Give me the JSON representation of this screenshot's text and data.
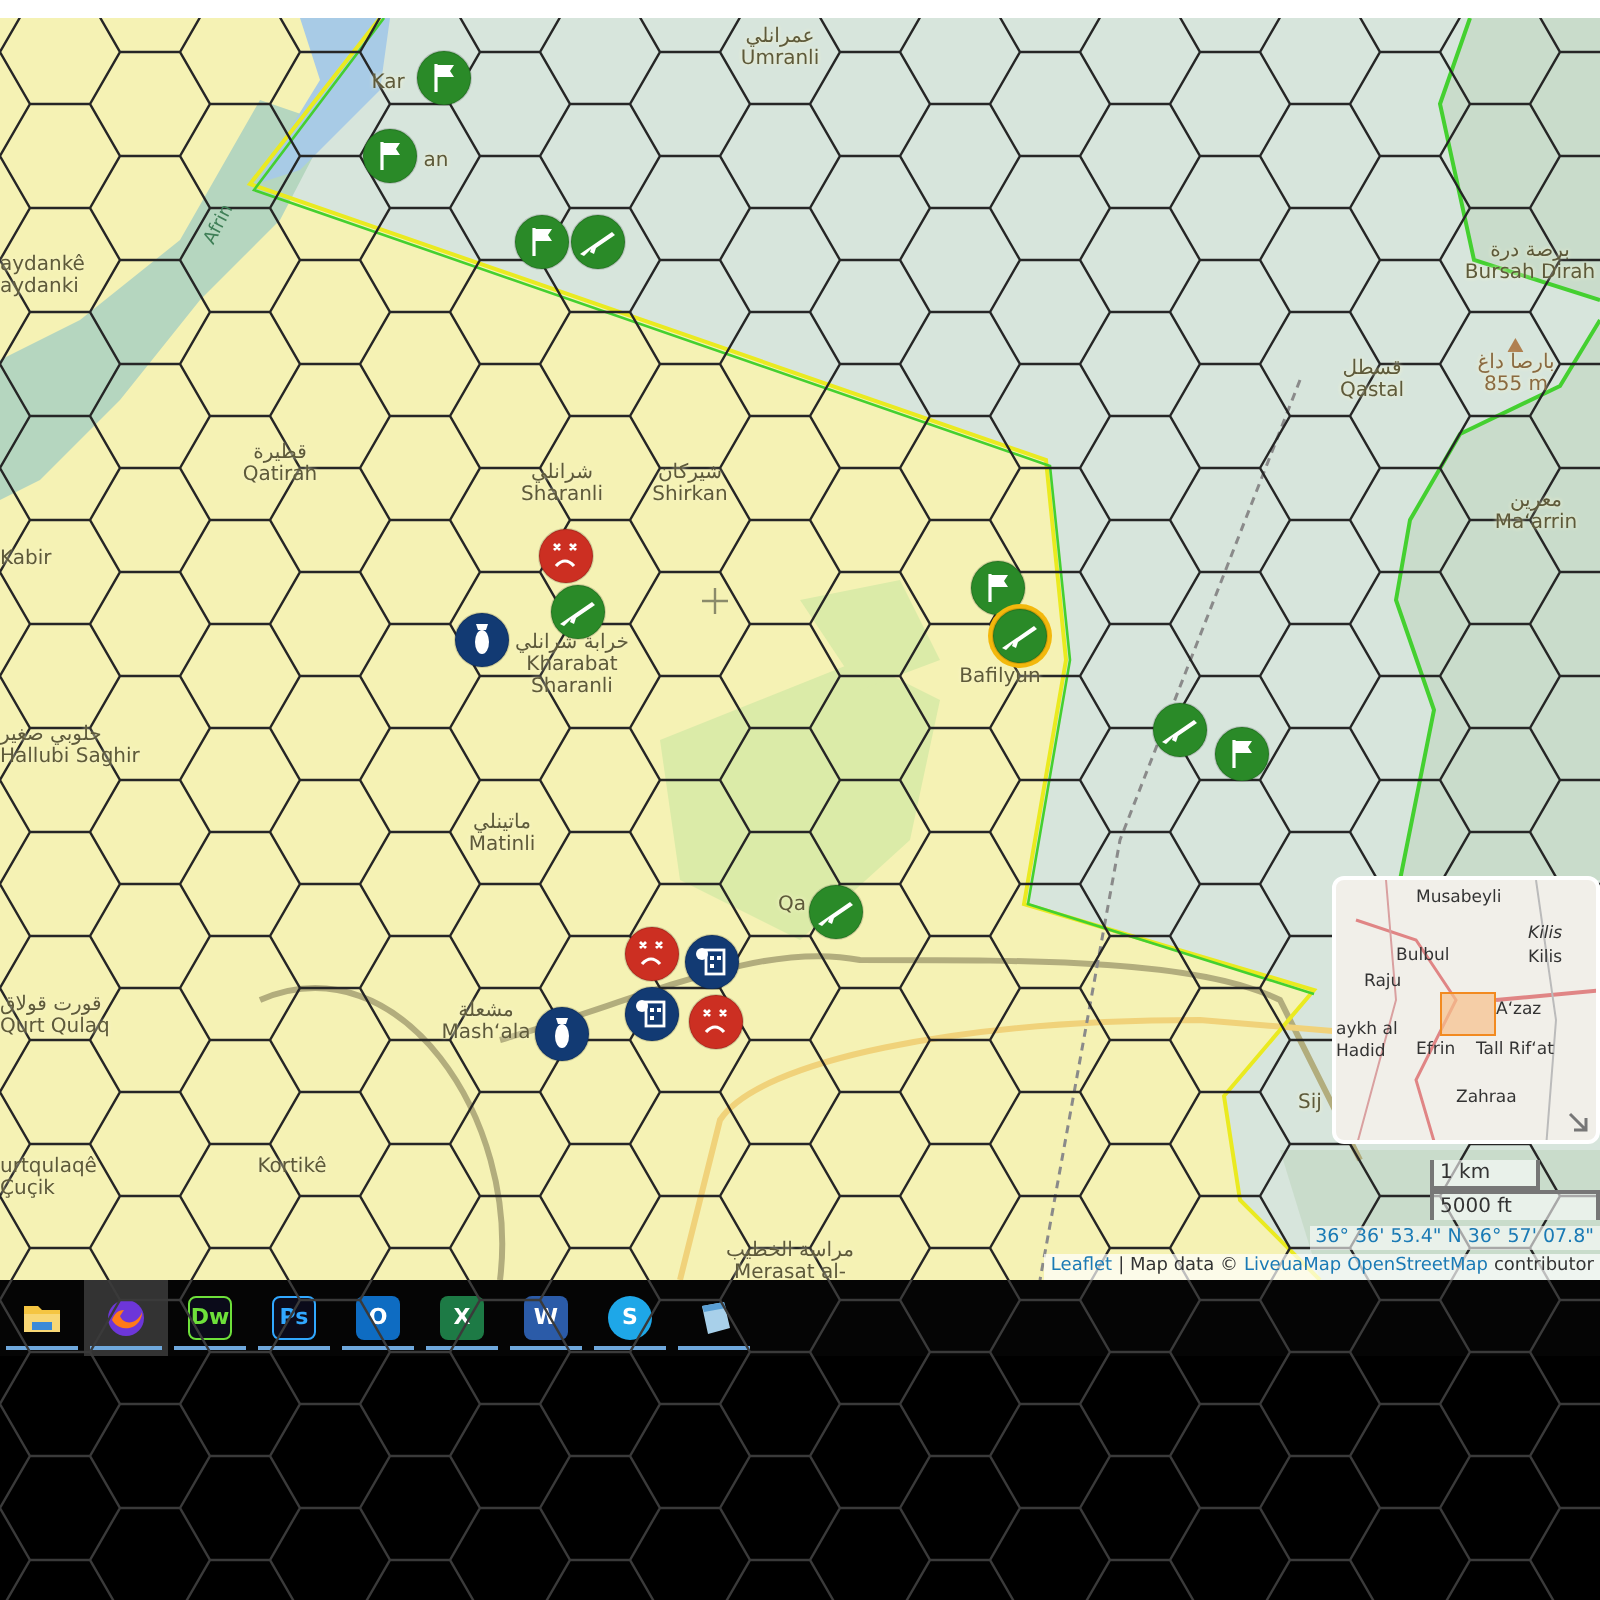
{
  "map": {
    "places": [
      {
        "kind": "town",
        "lines": [
          "عمرانلي",
          "Umranli"
        ]
      },
      {
        "kind": "town",
        "lines": [
          "Kar"
        ]
      },
      {
        "kind": "town",
        "lines": [
          "an"
        ]
      },
      {
        "kind": "town",
        "lines": [
          "aydankê",
          "aydanki"
        ]
      },
      {
        "kind": "town",
        "lines": [
          "قطيرة",
          "Qatirah"
        ]
      },
      {
        "kind": "town",
        "lines": [
          "Kabir"
        ]
      },
      {
        "kind": "town",
        "lines": [
          "شرانلي",
          "Sharanli"
        ]
      },
      {
        "kind": "town",
        "lines": [
          "شيركان",
          "Shirkan"
        ]
      },
      {
        "kind": "town",
        "lines": [
          "خرابة شرانلي",
          "Kharabat",
          "Sharanli"
        ]
      },
      {
        "kind": "town",
        "lines": [
          "Bafilyun"
        ]
      },
      {
        "kind": "town",
        "lines": [
          "برصة درة",
          "Bursah Dirah"
        ]
      },
      {
        "kind": "town",
        "lines": [
          "قسطل",
          "Qastal"
        ]
      },
      {
        "kind": "peak",
        "lines": [
          "بارصا داغ",
          "855 m"
        ]
      },
      {
        "kind": "town",
        "lines": [
          "معرين",
          "Ma‘arrin"
        ]
      },
      {
        "kind": "town",
        "lines": [
          "حلوبي صغير",
          "Hallubi Saghir"
        ]
      },
      {
        "kind": "town",
        "lines": [
          "ماتينلي",
          "Matinli"
        ]
      },
      {
        "kind": "town",
        "lines": [
          "Qa"
        ]
      },
      {
        "kind": "town",
        "lines": [
          "قورت قولاق",
          "Qurt Qulaq"
        ]
      },
      {
        "kind": "town",
        "lines": [
          "مشعلة",
          "Mash‘ala"
        ]
      },
      {
        "kind": "town",
        "lines": [
          "urtqulaqê",
          "Çuçik"
        ]
      },
      {
        "kind": "town",
        "lines": [
          "Kortikê"
        ]
      },
      {
        "kind": "town",
        "lines": [
          "مراسة الخطيب",
          "Merasat al-"
        ]
      },
      {
        "kind": "town",
        "lines": [
          "Sij"
        ]
      }
    ],
    "river_label": "Afrin",
    "markers": [
      {
        "kind": "flag",
        "selected": false
      },
      {
        "kind": "flag",
        "selected": false
      },
      {
        "kind": "flag",
        "selected": false
      },
      {
        "kind": "rifle",
        "selected": false
      },
      {
        "kind": "sad",
        "selected": false
      },
      {
        "kind": "rifle",
        "selected": false
      },
      {
        "kind": "bomb",
        "selected": false
      },
      {
        "kind": "flag",
        "selected": false
      },
      {
        "kind": "rifle",
        "selected": true
      },
      {
        "kind": "rifle",
        "selected": false
      },
      {
        "kind": "flag",
        "selected": false
      },
      {
        "kind": "rifle",
        "selected": false
      },
      {
        "kind": "sad",
        "selected": false
      },
      {
        "kind": "building",
        "selected": false
      },
      {
        "kind": "building",
        "selected": false
      },
      {
        "kind": "sad",
        "selected": false
      },
      {
        "kind": "bomb",
        "selected": false
      }
    ]
  },
  "minimap": {
    "places": [
      "Musabeyli",
      "Bulbul",
      "Kilis",
      "Kilis",
      "Raju",
      "aykh al",
      "Hadid",
      "Efrin",
      "A‘zaz",
      "Tall Rif‘at",
      "Zahraa"
    ]
  },
  "scale": [
    "1 km",
    "5000 ft"
  ],
  "coordinates": "36° 36' 53.4\" N 36° 57' 07.8\"",
  "attribution": [
    {
      "text": "Leaflet",
      "link": true
    },
    {
      "text": "| Map data ©",
      "link": false
    },
    {
      "text": "LiveuaMap",
      "link": true
    },
    {
      "text": "OpenStreetMap",
      "link": true
    },
    {
      "text": "contributor",
      "link": false
    }
  ],
  "taskbar": {
    "items": [
      {
        "kind": "folder",
        "selected": false
      },
      {
        "kind": "browser",
        "selected": true
      },
      {
        "kind": "letters",
        "label": "Dw",
        "selected": false
      },
      {
        "kind": "letters",
        "label": "Ps",
        "selected": false
      },
      {
        "kind": "mail",
        "label": "O",
        "selected": false
      },
      {
        "kind": "sheet",
        "label": "X",
        "selected": false
      },
      {
        "kind": "doc",
        "label": "W",
        "selected": false
      },
      {
        "kind": "chat",
        "label": "S",
        "selected": false
      },
      {
        "kind": "notepad",
        "selected": false
      }
    ]
  }
}
